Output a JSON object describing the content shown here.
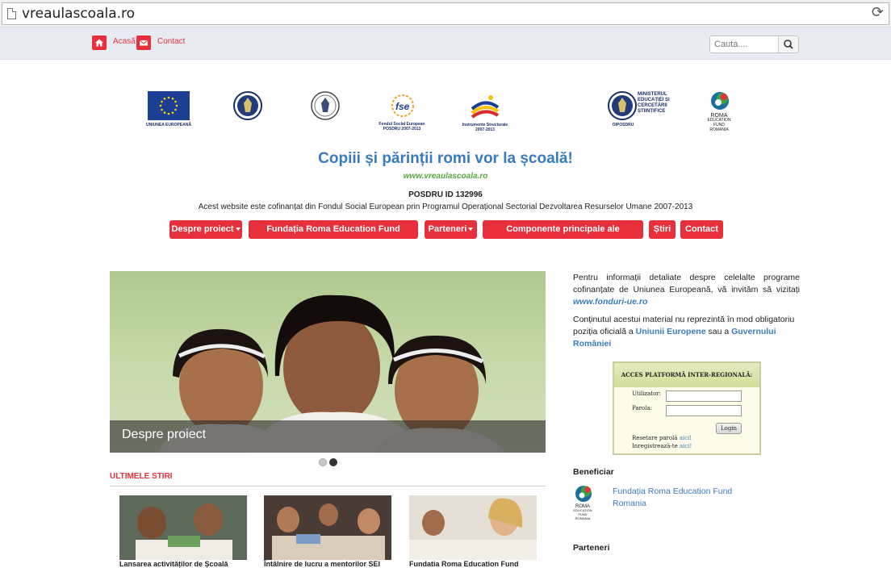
{
  "browser": {
    "url": "vreaulascoala.ro"
  },
  "topbar": {
    "home_label": "Acasă",
    "contact_label": "Contact",
    "search_placeholder": "Cauta...."
  },
  "logos": {
    "eu_caption": "UNIUNEA EUROPEANĂ",
    "fse_caption_1": "Fondul Social European",
    "fse_caption_2": "POSDRU 2007-2013",
    "is_caption_1": "Instrumente Structurale",
    "is_caption_2": "2007-2013",
    "min_caption_1": "MINISTERUL",
    "min_caption_2": "EDUCAȚIEI ȘI",
    "min_caption_3": "CERCETĂRII",
    "min_caption_4": "ȘTIINȚIFICE",
    "min_sub": "OIPOSDRU",
    "ref_1": "ROMA",
    "ref_2": "EDUCATION",
    "ref_3": "FUND",
    "ref_4": "ROMANIA"
  },
  "header": {
    "headline": "Copiii și părinții romi vor la școală!",
    "url": "www.vreaulascoala.ro",
    "posdru": "POSDRU ID 132996",
    "cofin": "Acest website este cofinanțat din Fondul Social European prin Programul Operațional Sectorial Dezvoltarea Resurselor Umane 2007-2013"
  },
  "nav": {
    "despre": "Despre proiect",
    "fundatia": "Fundația Roma Education Fund România",
    "parteneri": "Parteneri",
    "componente": "Componente principale ale proiectului",
    "stiri": "Știri",
    "contact": "Contact"
  },
  "hero": {
    "caption": "Despre proiect"
  },
  "news": {
    "title": "ULTIMELE STIRI",
    "items": [
      {
        "caption": "Lansarea activităților de Școală"
      },
      {
        "caption": "Întâlnire de lucru a mentorilor SEI"
      },
      {
        "caption": "Fundatia Roma Education Fund"
      }
    ]
  },
  "right": {
    "info_1": "Pentru informații detaliate despre celelalte programe cofinanțate de Uniunea Europeană, vă invităm să vizitați",
    "info_link": "www.fonduri-ue.ro",
    "disc_1": "Conținutul acestui material nu reprezintă în mod obligatoriu poziția oficială a",
    "disc_link_1": "Uniunii Europene",
    "disc_2": "sau a",
    "disc_link_2": "Guvernului României"
  },
  "login": {
    "title": "ACCES PLATFORMĂ INTER-REGIONALĂ:",
    "user_label": "Utilizator:",
    "pass_label": "Parola:",
    "button": "Login",
    "reset_text": "Resetare parolă",
    "reset_link": "aici!",
    "register_text": "Inregistrează-te",
    "register_link": "aici!"
  },
  "beneficiar": {
    "title": "Beneficiar",
    "link": "Fundația Roma Education Fund Romania",
    "logo_1": "ROMA",
    "logo_2": "EDUCATION",
    "logo_3": "FUND",
    "logo_4": "ROMANIA"
  },
  "parteneri_title": "Parteneri"
}
